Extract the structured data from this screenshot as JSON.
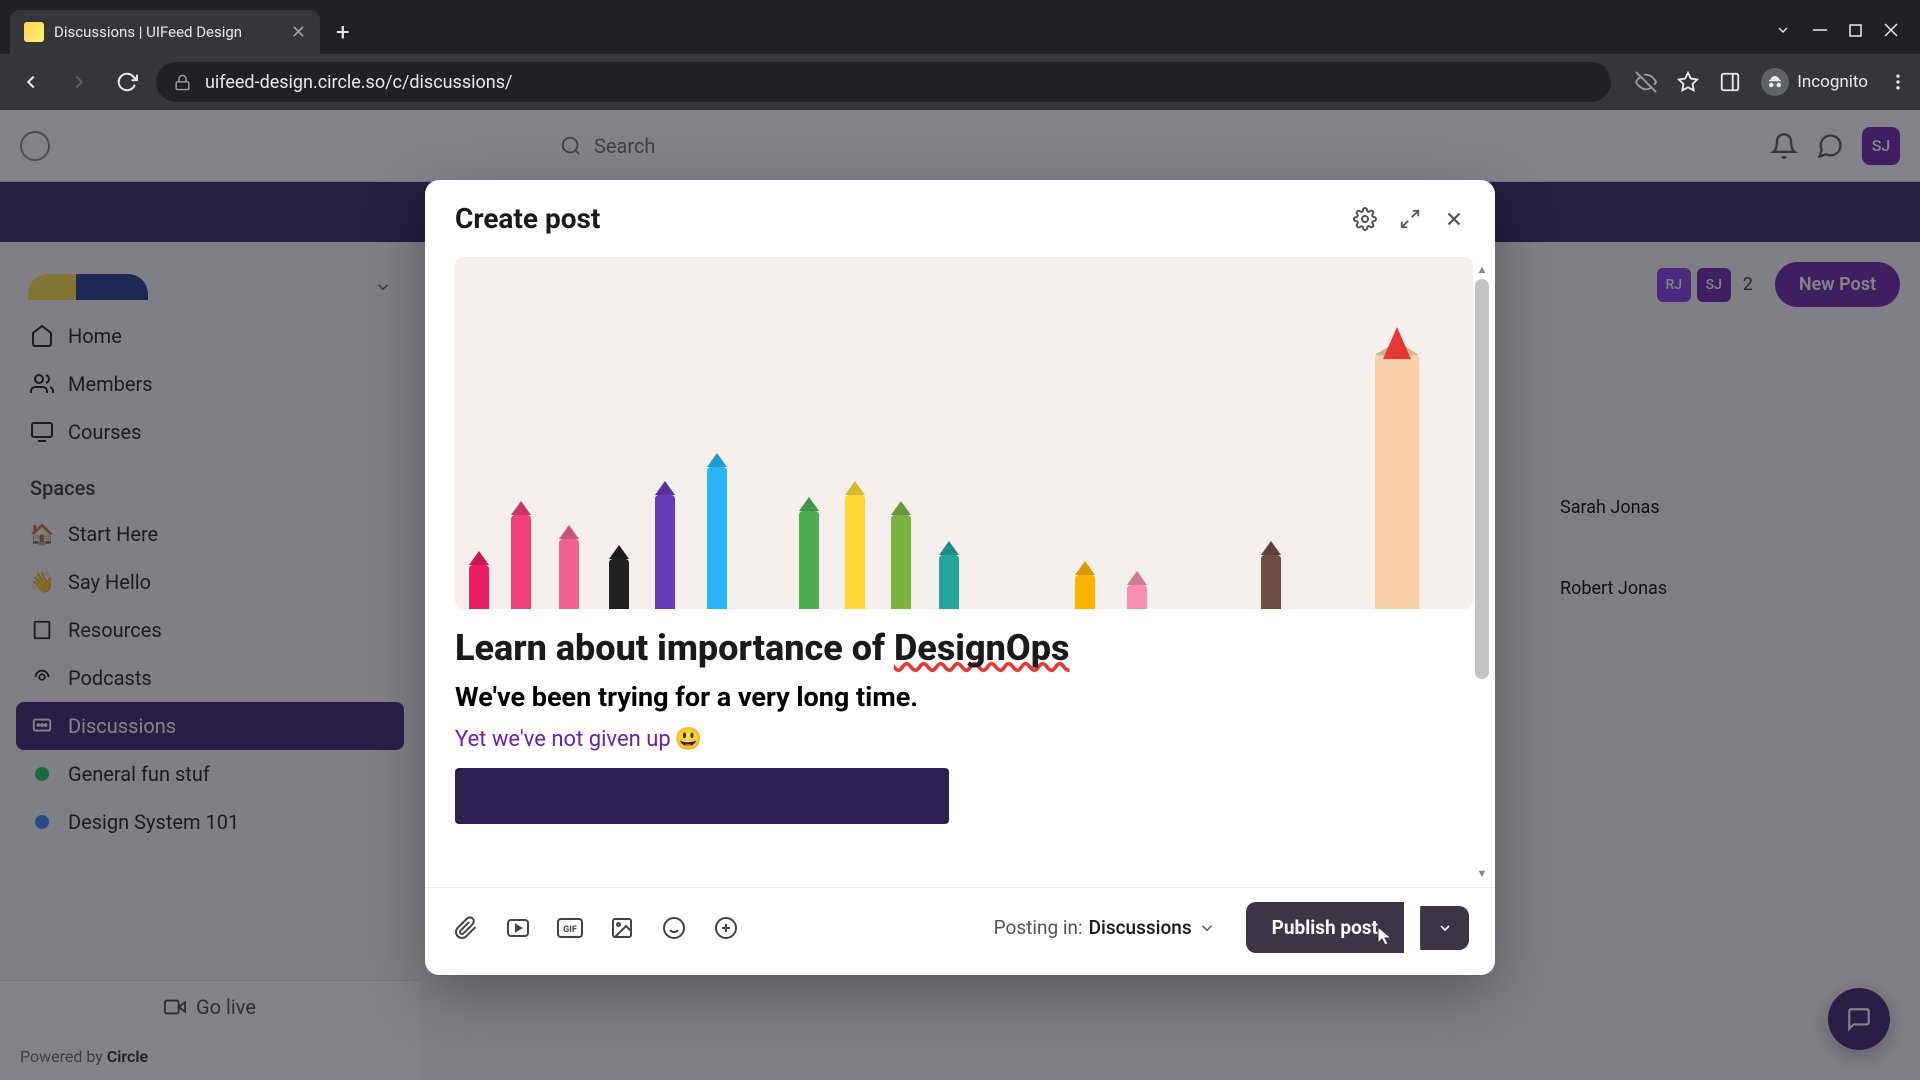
{
  "browser": {
    "tab_title": "Discussions | UIFeed Design",
    "url": "uifeed-design.circle.so/c/discussions/",
    "incognito_label": "Incognito"
  },
  "header": {
    "search_placeholder": "Search",
    "avatar_initials": "SJ"
  },
  "sidebar": {
    "nav": {
      "home": "Home",
      "members": "Members",
      "courses": "Courses"
    },
    "section_label": "Spaces",
    "spaces": {
      "start_here": "Start Here",
      "say_hello": "Say Hello",
      "resources": "Resources",
      "podcasts": "Podcasts",
      "discussions": "Discussions",
      "general_fun": "General fun stuf",
      "design_system": "Design System 101"
    },
    "go_live": "Go live",
    "powered_prefix": "Powered by ",
    "powered_brand": "Circle"
  },
  "right_panel": {
    "avatar1": "RJ",
    "avatar2": "SJ",
    "count": "2",
    "new_post": "New Post",
    "person1": "Sarah Jonas",
    "person2": "Robert Jonas"
  },
  "modal": {
    "title": "Create post",
    "post_title_prefix": "Learn about importance of ",
    "post_title_spell": "DesignOps",
    "post_subtitle": "We've been trying for a very long time.",
    "post_link_text": "Yet we've not given up",
    "emoji": "😃",
    "posting_in_label": "Posting in: ",
    "posting_in_space": "Discussions",
    "publish_label": "Publish post"
  }
}
